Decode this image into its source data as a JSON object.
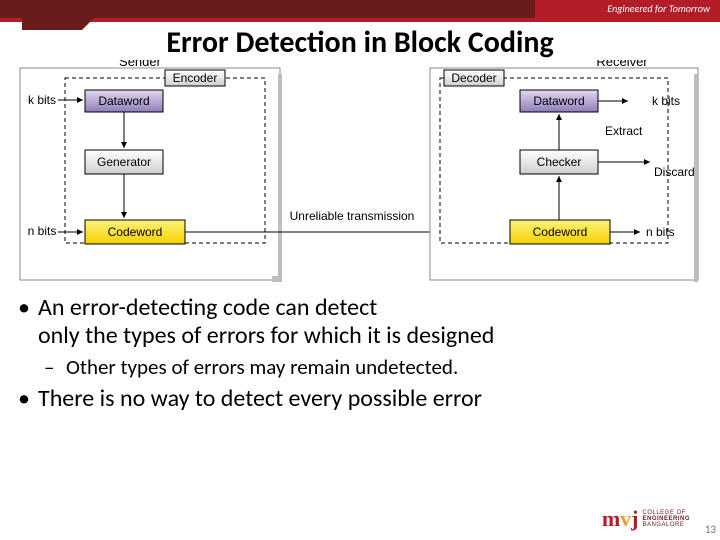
{
  "header": {
    "tagline": "Engineered for Tomorrow"
  },
  "title": "Error Detection in Block Coding",
  "diagram": {
    "sender": {
      "title": "Sender",
      "encoder": "Encoder",
      "dataword_label": "k bits",
      "dataword": "Dataword",
      "generator": "Generator",
      "codeword_label": "n bits",
      "codeword": "Codeword"
    },
    "channel": {
      "label": "Unreliable transmission"
    },
    "receiver": {
      "title": "Receiver",
      "decoder": "Decoder",
      "dataword_label": "k bits",
      "dataword": "Dataword",
      "extract": "Extract",
      "checker": "Checker",
      "discard": "Discard",
      "codeword_label": "n bits",
      "codeword": "Codeword"
    }
  },
  "bullets": {
    "b1": "An error-detecting code can detect",
    "b1b": "only the types of errors for which it is designed",
    "s1": "Other types of errors may remain undetected.",
    "b2": "There is no way to detect every possible error"
  },
  "logo": {
    "l1": "COLLEGE OF",
    "l2": "ENGINEERING",
    "l3": "BANGALORE"
  },
  "page": "13"
}
